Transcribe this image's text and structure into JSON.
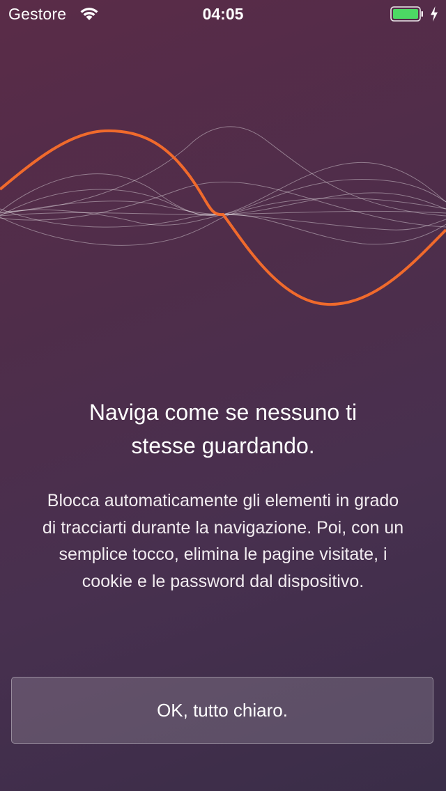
{
  "status_bar": {
    "carrier": "Gestore",
    "time": "04:05",
    "wifi_icon": "wifi-icon",
    "battery_icon": "battery-icon",
    "charging_icon": "charging-bolt-icon",
    "battery_color": "#4cd964"
  },
  "hero": {
    "accent_color": "#f06a2c",
    "wave_icon": "sound-wave-illustration"
  },
  "headline": {
    "line1": "Naviga come se nessuno ti",
    "line2": "stesse guardando."
  },
  "description": {
    "line1": "Blocca automaticamente gli elementi in grado",
    "line2": "di tracciarti durante la navigazione. Poi, con un",
    "line3": "semplice tocco, elimina le pagine visitate, i",
    "line4": "cookie e le password dal dispositivo."
  },
  "button": {
    "label": "OK, tutto chiaro."
  }
}
